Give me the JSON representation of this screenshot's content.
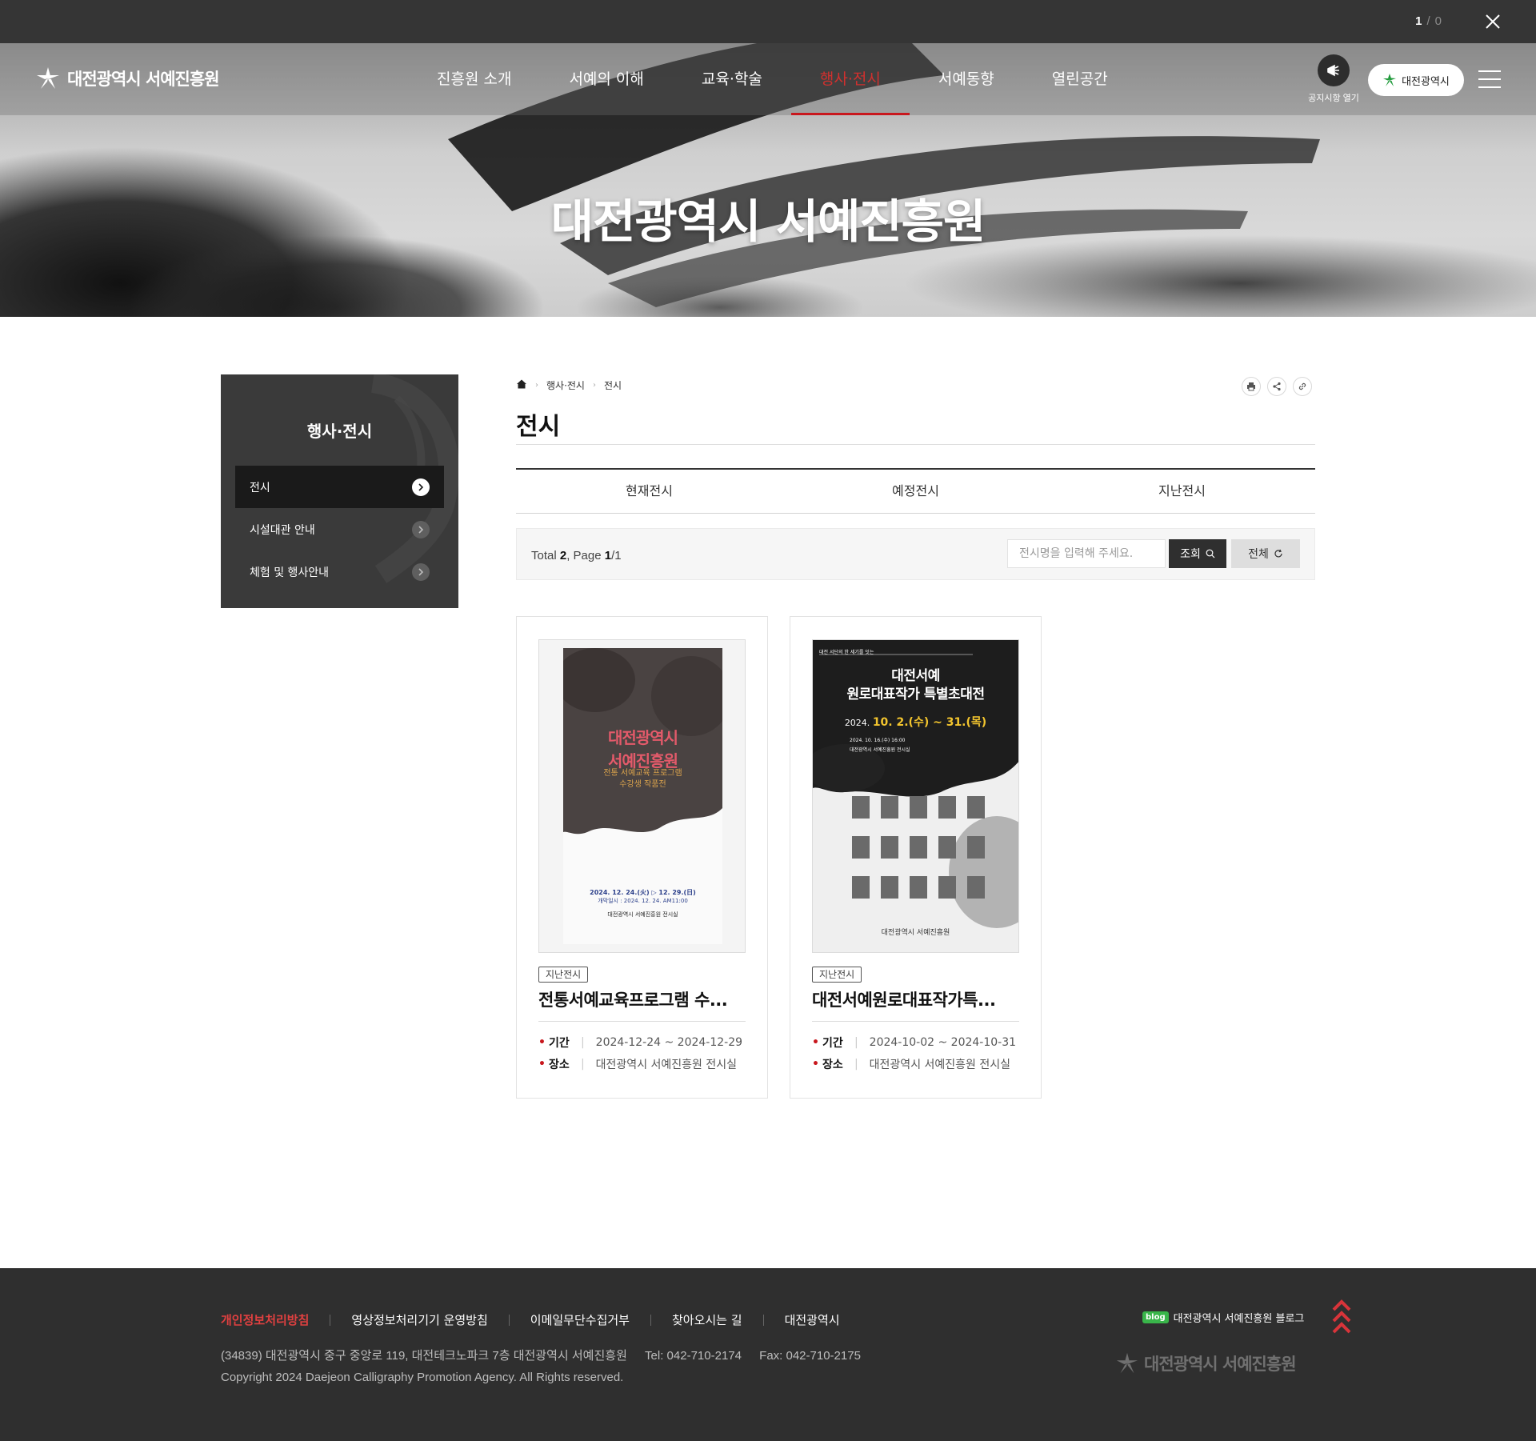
{
  "topbar": {
    "current": "1",
    "separator": "/",
    "total": "0"
  },
  "header": {
    "logo_text": "대전광역시 서예진흥원",
    "nav": [
      "진흥원 소개",
      "서예의 이해",
      "교육·학술",
      "행사·전시",
      "서예동향",
      "열린공간"
    ],
    "active_nav": "행사·전시",
    "notice_label": "공지시항 열기",
    "city_button": "대전광역시",
    "accent_color": "#c8171d"
  },
  "hero": {
    "title": "대전광역시 서예진흥원"
  },
  "sidebar": {
    "title": "행사·전시",
    "items": [
      {
        "label": "전시",
        "active": true
      },
      {
        "label": "시설대관 안내",
        "active": false
      },
      {
        "label": "체험 및 행사안내",
        "active": false
      }
    ]
  },
  "breadcrumb": {
    "home_icon": "home-icon",
    "level1": "행사·전시",
    "level2": "전시"
  },
  "page": {
    "title": "전시"
  },
  "tabs": [
    "현재전시",
    "예정전시",
    "지난전시"
  ],
  "search": {
    "total_label": "Total",
    "total": "2",
    "page_label": "Page",
    "page": "1",
    "pages": "/1",
    "placeholder": "전시명을 입력해 주세요.",
    "search_button": "조회",
    "reset_button": "전체"
  },
  "cards": [
    {
      "badge": "지난전시",
      "title": "전통서예교육프로그램 수...",
      "period_label": "기간",
      "period": "2024-12-24 ~ 2024-12-29",
      "place_label": "장소",
      "place": "대전광역시 서예진흥원 전시실",
      "poster": {
        "title_1": "대전광역시",
        "title_2": "서예진흥원",
        "sub_1": "전통 서예교육 프로그램",
        "sub_2": "수강생 작품전",
        "date_line": "2024. 12. 24.(火) ▷ 12. 29.(日)",
        "opening": "개막일시 : 2024. 12. 24. AM11:00",
        "venue": "대전광역시 서예진흥원 전시실"
      }
    },
    {
      "badge": "지난전시",
      "title": "대전서예원로대표작가특...",
      "period_label": "기간",
      "period": "2024-10-02 ~ 2024-10-31",
      "place_label": "장소",
      "place": "대전광역시 서예진흥원 전시실",
      "poster": {
        "subtitle": "대전 서단의 한 세기를 잇는",
        "title_1": "대전서예",
        "title_2": "원로대표작가 특별초대전",
        "date_prefix": "2024.",
        "date_highlight": "10. 2.(수) ~ 31.(목)",
        "opening": "2024. 10. 16.(수) 16:00",
        "venue": "대전광역시 서예진흥원 전시실",
        "footer": "대전광역시 서예진흥원"
      }
    }
  ],
  "footer": {
    "links": [
      "개인정보처리방침",
      "영상정보처리기기 운영방침",
      "이메일무단수집거부",
      "찾아오시는 길",
      "대전광역시"
    ],
    "address": "(34839) 대전광역시 중구 중앙로 119, 대전테크노파크 7층 대전광역시 서예진흥원",
    "tel": "Tel: 042-710-2174",
    "fax": "Fax: 042-710-2175",
    "copyright": "Copyright 2024 Daejeon Calligraphy Promotion Agency. All Rights reserved.",
    "blog_badge": "blog",
    "blog_label": "대전광역시 서예진흥원 블로그",
    "logo_text": "대전광역시 서예진흥원"
  }
}
